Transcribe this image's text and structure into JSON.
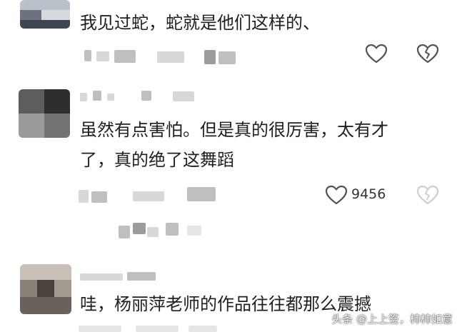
{
  "comments": [
    {
      "text": "我见过蛇，蛇就是他们这样的、"
    },
    {
      "text_line1": "虽然有点害怕。但是真的很厉害，太有才",
      "text_line2": "了，真的绝了这舞蹈",
      "like_count": "9456"
    },
    {
      "text": "哇，杨丽萍老师的作品往往都那么震撼"
    }
  ],
  "watermark": "头条 @上上签，柿柿如意",
  "icons": [
    "heart-outline-icon",
    "broken-heart-icon"
  ]
}
